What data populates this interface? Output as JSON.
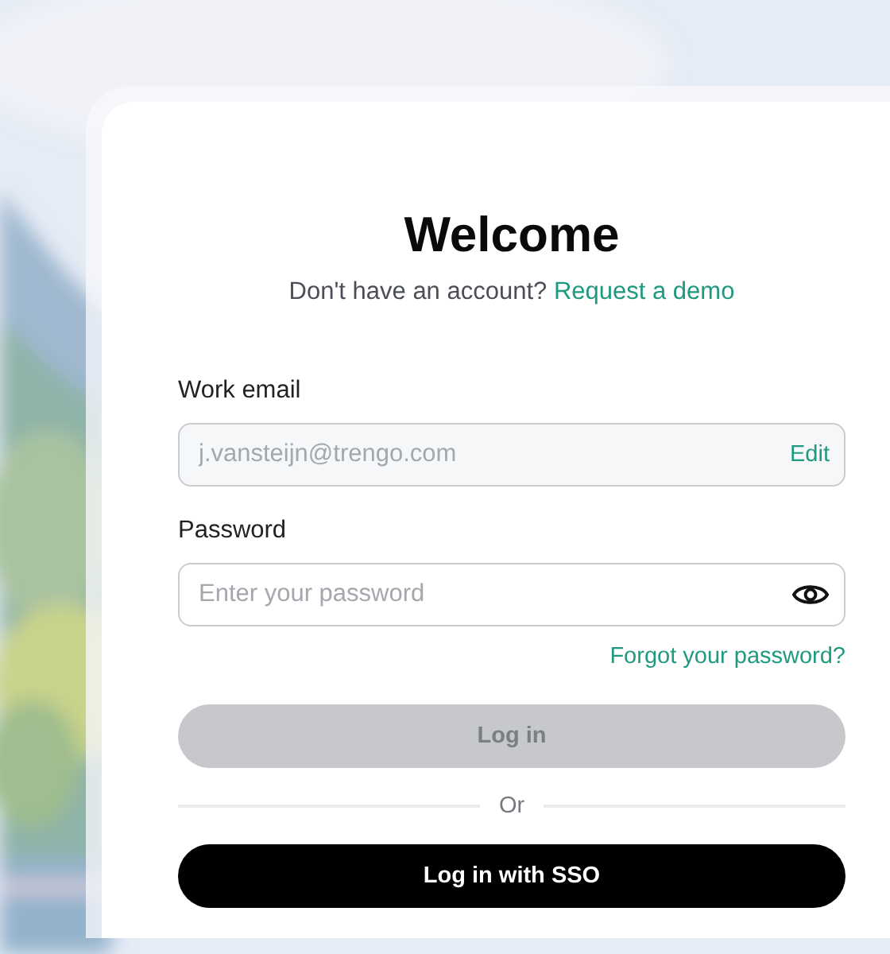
{
  "title": "Welcome",
  "signup": {
    "prompt": "Don't have an account?",
    "link": "Request a demo"
  },
  "fields": [
    {
      "kind": "email",
      "label": "Work email",
      "value": "j.vansteijn@trengo.com",
      "disabled": true,
      "action": "Edit"
    },
    {
      "kind": "password",
      "label": "Password",
      "placeholder": "Enter your password"
    }
  ],
  "forgot_link": "Forgot your password?",
  "login_button": {
    "label": "Log in",
    "disabled": true
  },
  "divider": "Or",
  "sso_button": {
    "label": "Log in with SSO"
  }
}
